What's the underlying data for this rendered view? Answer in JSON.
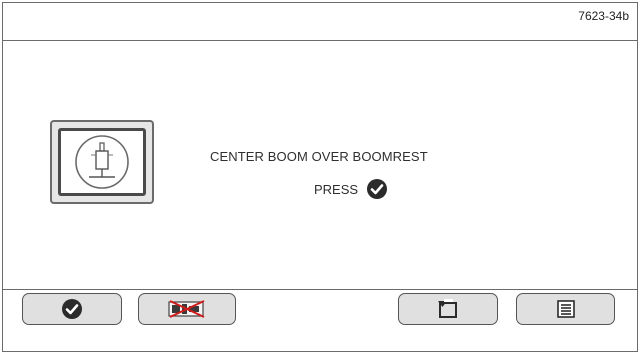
{
  "header": {
    "document_number": "7623-34b"
  },
  "main": {
    "message": "CENTER BOOM OVER BOOMREST",
    "press_label": "PRESS",
    "press_icon": "check-circle-icon",
    "illustration_icon": "boom-over-boomrest-icon"
  },
  "footer": {
    "buttons": [
      {
        "id": "confirm",
        "icon": "check-circle-icon"
      },
      {
        "id": "function-disabled",
        "icon": "crossed-out-function-icon"
      },
      {
        "id": "back",
        "icon": "back-arrow-icon"
      },
      {
        "id": "menu",
        "icon": "menu-list-icon"
      }
    ]
  },
  "colors": {
    "frame": "#6a6a6a",
    "button_fill": "#e0e0e0",
    "button_border": "#555555",
    "icon_dark": "#2b2b2b",
    "disabled_cross": "#d11b1b",
    "text": "#2f2f2f"
  }
}
